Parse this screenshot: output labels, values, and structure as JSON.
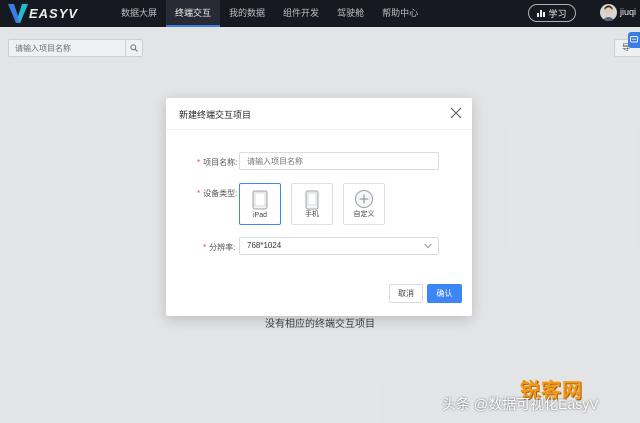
{
  "app": {
    "logo_text": "EASYV",
    "brand_color": "#3d86f5"
  },
  "nav": {
    "items": [
      {
        "label": "数据大屏",
        "active": false
      },
      {
        "label": "终端交互",
        "active": true
      },
      {
        "label": "我的数据",
        "active": false
      },
      {
        "label": "组件开发",
        "active": false
      },
      {
        "label": "驾驶舱",
        "active": false
      },
      {
        "label": "帮助中心",
        "active": false
      }
    ],
    "learn_label": "学习",
    "username": "jiuqi"
  },
  "toolbar": {
    "search_placeholder": "请输入项目名称",
    "export_label": "导"
  },
  "empty_state": "没有相应的终端交互项目",
  "modal": {
    "title": "新建终端交互项目",
    "name_label": "项目名称:",
    "name_placeholder": "请输入项目名称",
    "device_label": "设备类型:",
    "devices": [
      {
        "label": "iPad",
        "icon": "tablet-icon",
        "selected": true
      },
      {
        "label": "手机",
        "icon": "phone-icon",
        "selected": false
      },
      {
        "label": "自定义",
        "icon": "plus-circle-icon",
        "selected": false
      }
    ],
    "resolution_label": "分辨率:",
    "resolution_value": "768*1024",
    "cancel_label": "取消",
    "confirm_label": "确认"
  },
  "watermark": {
    "logo": "锐客网",
    "text": "头条 @数据可视化EasyV"
  }
}
